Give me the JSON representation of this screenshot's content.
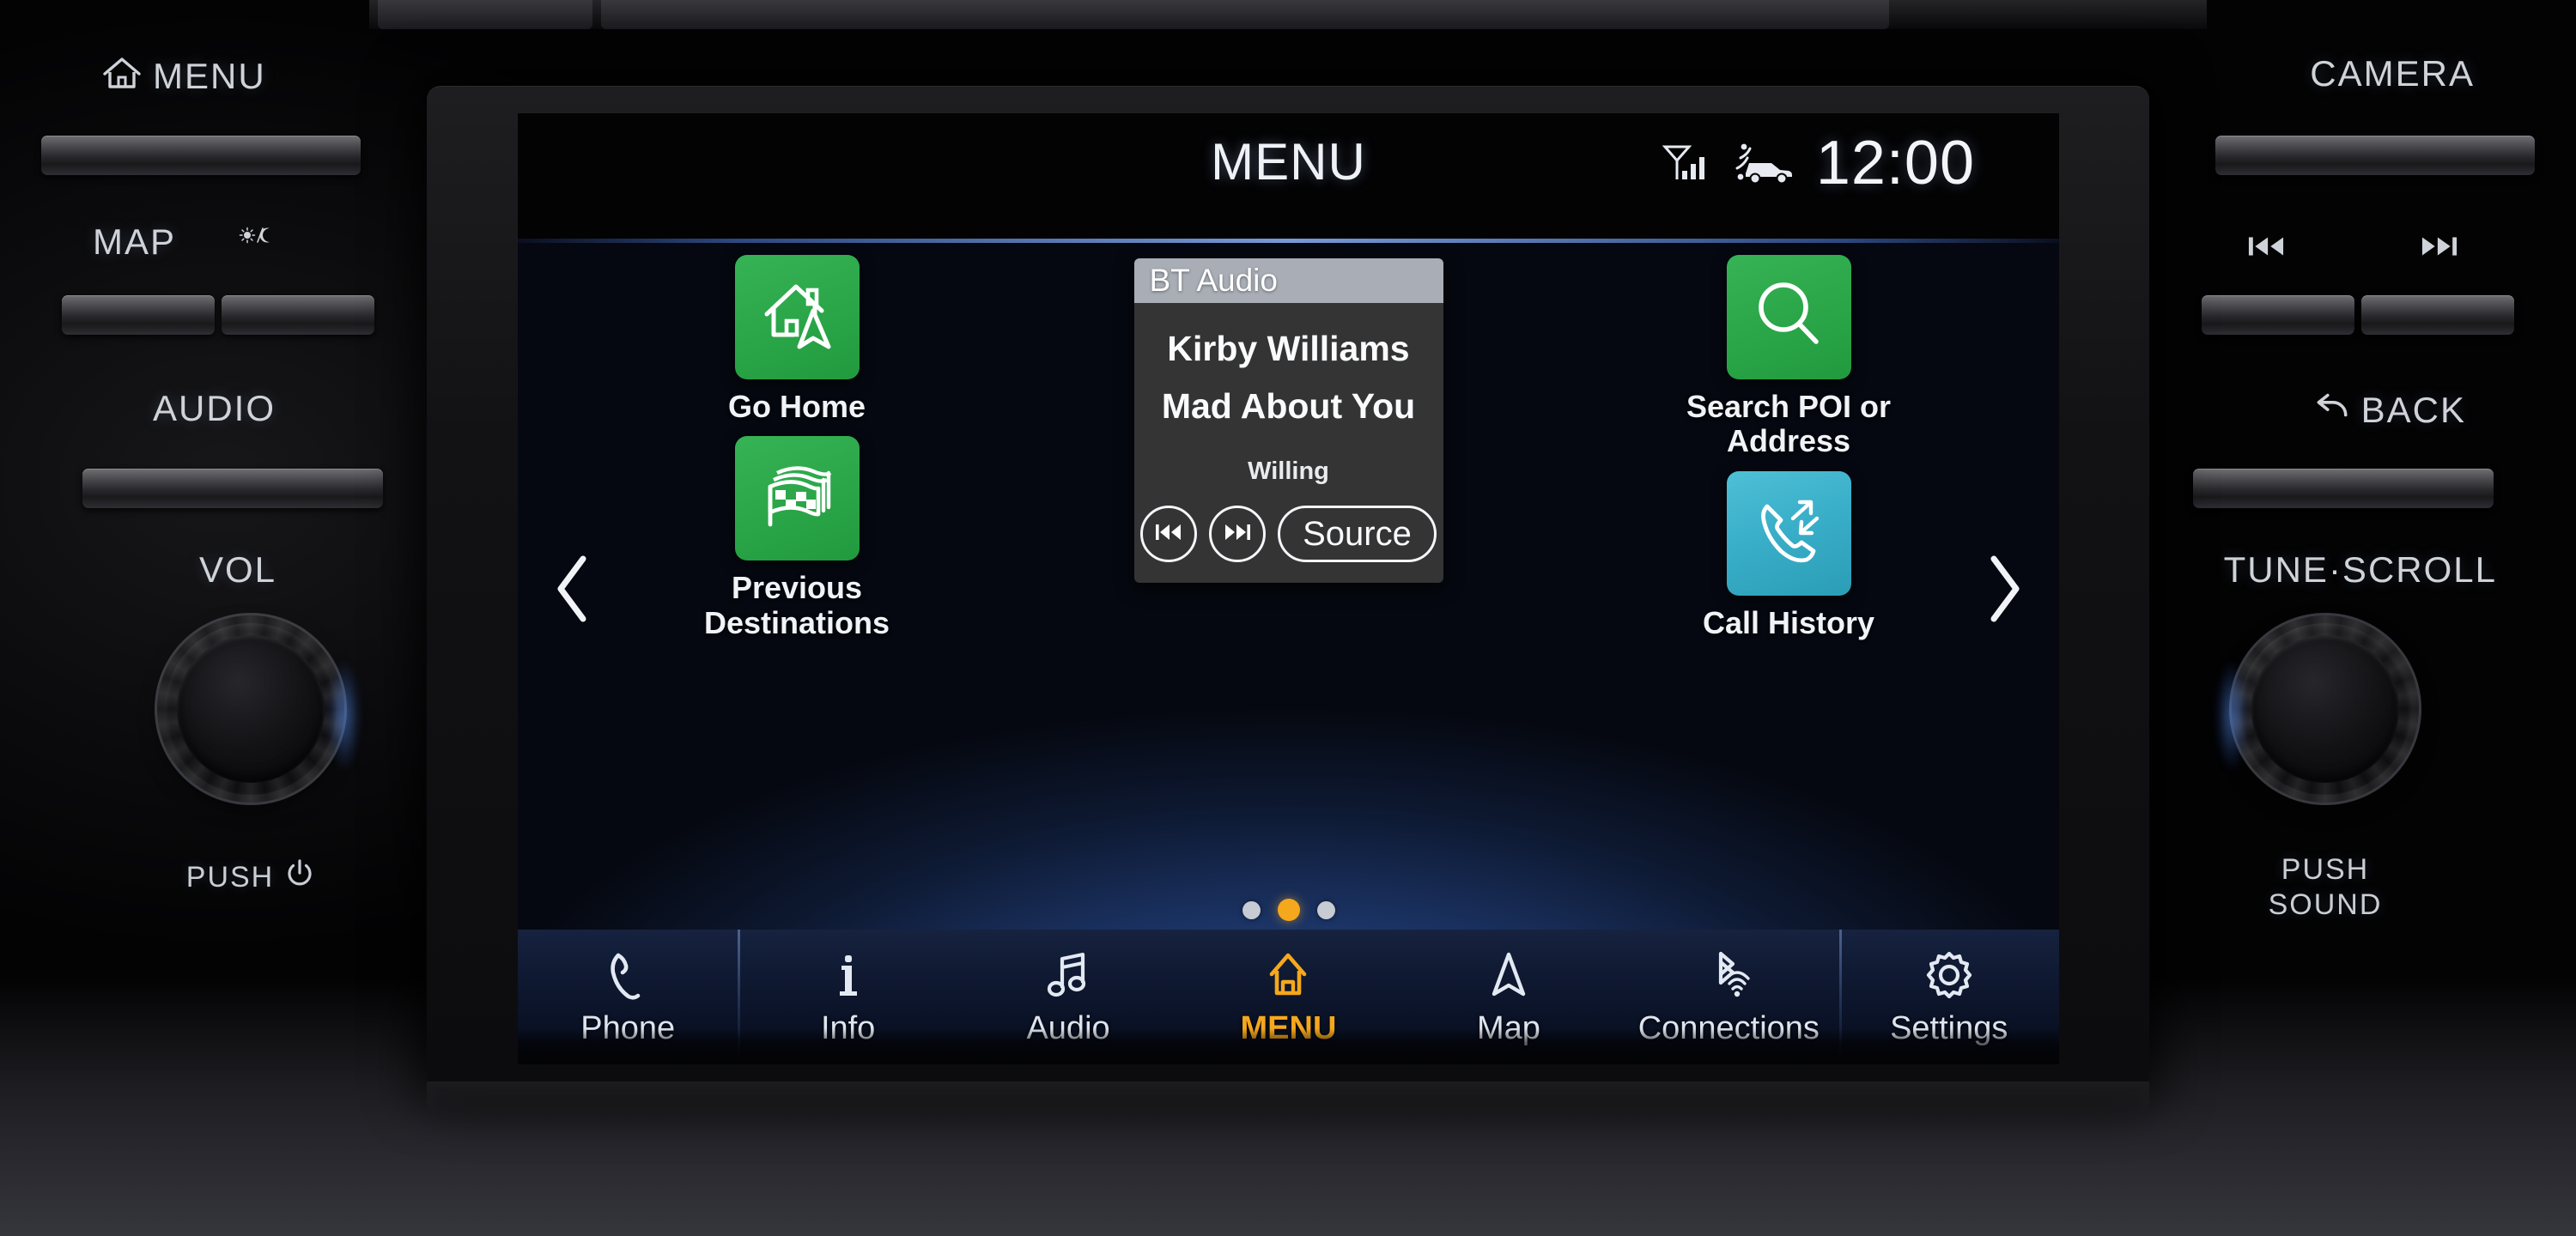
{
  "screen": {
    "status_bar": {
      "title": "MENU",
      "clock": "12:00",
      "signal_icon": "cellular-signal-icon",
      "connectivity_icon": "connected-car-icon"
    },
    "nav_arrows": {
      "prev": "chevron-left-icon",
      "next": "chevron-right-icon"
    },
    "tiles": [
      {
        "label": "Go Home",
        "icon": "home-navigation-icon",
        "color": "#2ca84a",
        "column": "left"
      },
      {
        "label": "Previous Destinations",
        "icon": "checkered-flags-icon",
        "color": "#2ca84a",
        "column": "left"
      },
      {
        "label": "Search POI or Address",
        "icon": "magnifier-icon",
        "color": "#2ca84a",
        "column": "right"
      },
      {
        "label": "Call History",
        "icon": "call-history-icon",
        "color": "#3aafc9",
        "column": "right"
      }
    ],
    "bt_audio_widget": {
      "header": "BT Audio",
      "artist": "Kirby Williams",
      "track": "Mad About You",
      "album": "Willing",
      "prev_icon": "previous-track-icon",
      "next_icon": "next-track-icon",
      "source_label": "Source"
    },
    "page_dots": {
      "count": 3,
      "active_index": 1,
      "active_color": "#f5a81c",
      "inactive_color": "#c6cbd4"
    },
    "bottom_nav": [
      {
        "label": "Phone",
        "icon": "phone-handset-icon",
        "active": false
      },
      {
        "label": "Info",
        "icon": "info-icon",
        "active": false
      },
      {
        "label": "Audio",
        "icon": "music-note-icon",
        "active": false
      },
      {
        "label": "MENU",
        "icon": "home-icon",
        "active": true
      },
      {
        "label": "Map",
        "icon": "navigation-arrow-icon",
        "active": false
      },
      {
        "label": "Connections",
        "icon": "bluetooth-wifi-icon",
        "active": false
      },
      {
        "label": "Settings",
        "icon": "gear-icon",
        "active": false
      }
    ]
  },
  "hardware": {
    "left": {
      "menu_label": "MENU",
      "menu_icon": "home-icon",
      "map_label": "MAP",
      "daynight_icon": "sun-moon-icon",
      "audio_label": "AUDIO",
      "vol_label": "VOL",
      "vol_push_label": "PUSH",
      "vol_power_icon": "power-icon"
    },
    "right": {
      "camera_label": "CAMERA",
      "prev_track_icon": "previous-track-icon",
      "next_track_icon": "next-track-icon",
      "back_label": "BACK",
      "back_icon": "back-arrow-icon",
      "tune_label": "TUNE·SCROLL",
      "tune_push_label": "PUSH",
      "tune_sound_label": "SOUND"
    }
  }
}
